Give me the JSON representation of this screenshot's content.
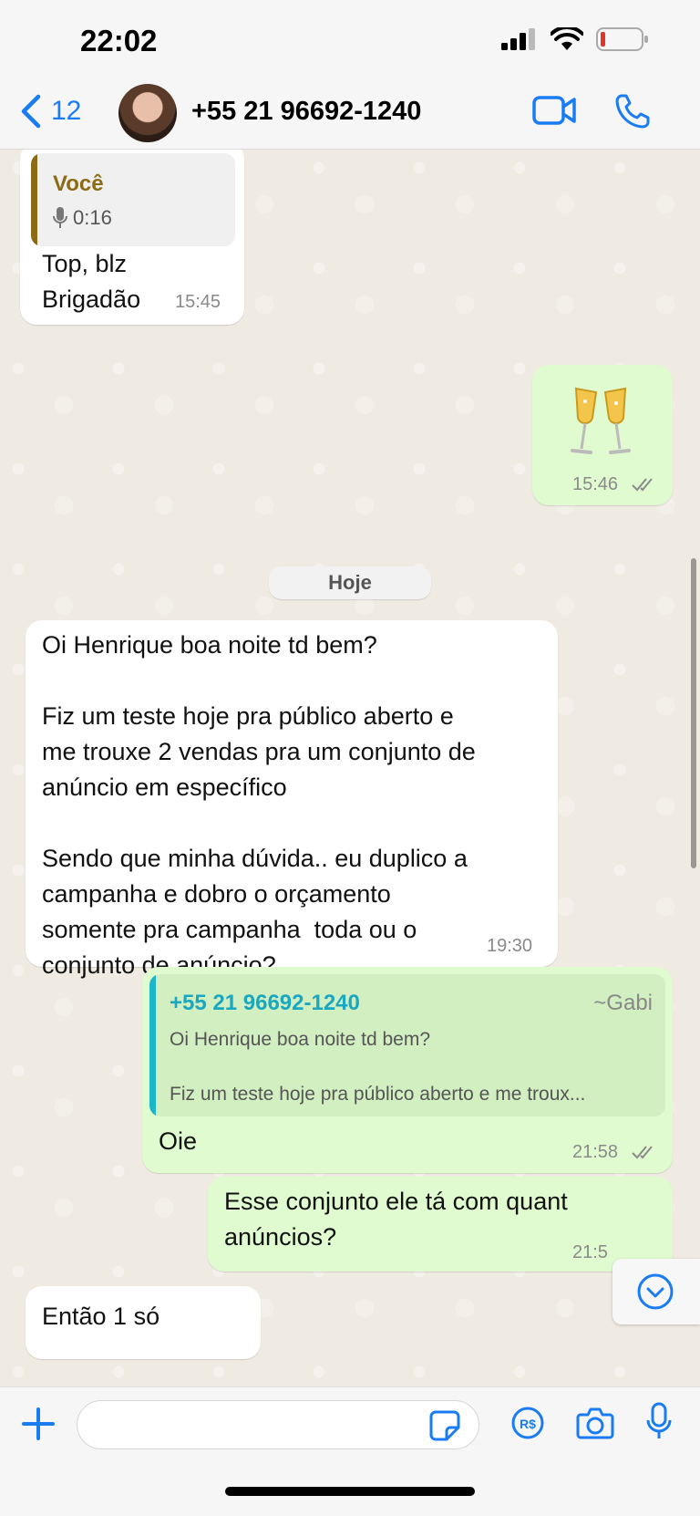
{
  "status_bar": {
    "time": "22:02"
  },
  "header": {
    "back_count": "12",
    "contact_name": "+55 21 96692-1240"
  },
  "colors": {
    "accent": "#1a7cf4",
    "incoming_bubble": "#ffffff",
    "outgoing_bubble": "#e1fbd0",
    "quote_self": "#8b6b14",
    "quote_contact": "#1bb7c9",
    "contact_name_in_quote": "#1aa7c0"
  },
  "messages": {
    "m1": {
      "quote_author": "Você",
      "quote_voice_duration": "0:16",
      "text": "Top, blz\nBrigadão",
      "time": "15:45"
    },
    "m2": {
      "emoji": "🥂",
      "time": "15:46"
    },
    "date_separator": "Hoje",
    "m3": {
      "text": "Oi Henrique boa noite td bem?\n\nFiz um teste hoje pra público aberto e\nme trouxe 2 vendas pra um conjunto de\nanúncio em específico\n\nSendo que minha dúvida.. eu duplico a\ncampanha e dobro o orçamento\nsomente pra campanha  toda ou o\nconjunto de anúncio?",
      "time": "19:30"
    },
    "m4": {
      "quote_author": "+55 21 96692-1240",
      "quote_pushname": "~Gabi",
      "quote_line1": "Oi Henrique boa noite td bem?",
      "quote_line2": "Fiz um teste hoje pra público aberto e me troux...",
      "text": "Oie",
      "time": "21:58"
    },
    "m5": {
      "text": "Esse conjunto ele tá com quant\nanúncios?",
      "time": "21:5"
    },
    "m6": {
      "text": "Então 1 só"
    }
  },
  "input": {
    "placeholder": ""
  },
  "icons": {
    "back": "chevron-left-icon",
    "video": "video-camera-icon",
    "call": "phone-icon",
    "plus": "plus-icon",
    "sticker": "sticker-icon",
    "payment": "pix-payment-icon",
    "camera": "camera-icon",
    "mic": "microphone-icon",
    "scroll_down": "chevron-down-circle-icon"
  }
}
